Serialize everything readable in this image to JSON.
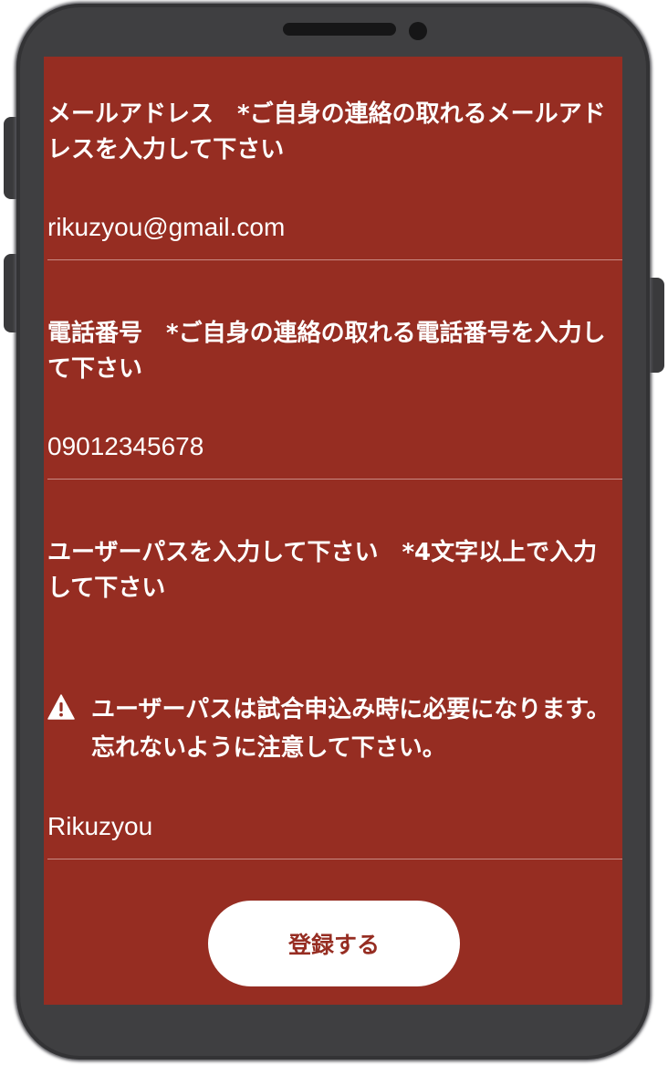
{
  "form": {
    "email": {
      "label": "メールアドレス　*ご自身の連絡の取れるメールアドレスを入力して下さい",
      "value": "rikuzyou@gmail.com"
    },
    "phone": {
      "label": "電話番号　*ご自身の連絡の取れる電話番号を入力して下さい",
      "value": "09012345678"
    },
    "userpass": {
      "label": "ユーザーパスを入力して下さい　*4文字以上で入力して下さい",
      "warning_icon": "warning-triangle-icon",
      "warning": "ユーザーパスは試合申込み時に必要になります。忘れないように注意して下さい。",
      "value": "Rikuzyou"
    },
    "submit_label": "登録する"
  },
  "colors": {
    "screen_background": "#962d22",
    "button_background": "#ffffff",
    "button_text": "#962d22",
    "phone_frame": "#3f3f41"
  }
}
